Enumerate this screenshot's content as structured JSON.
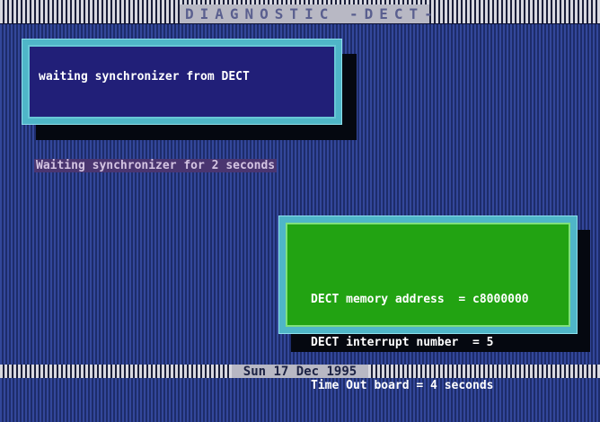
{
  "header": {
    "title": "DIAGNOSTIC -DECT-"
  },
  "message_box": {
    "text": "waiting synchronizer from DECT"
  },
  "status": {
    "text": "Waiting synchronizer for 2 seconds"
  },
  "info_box": {
    "lines": [
      "DECT memory address  = c8000000",
      "DECT interrupt number  = 5",
      "Time Out board = 4 seconds"
    ]
  },
  "footer": {
    "date": "Sun 17 Dec 1995"
  }
}
